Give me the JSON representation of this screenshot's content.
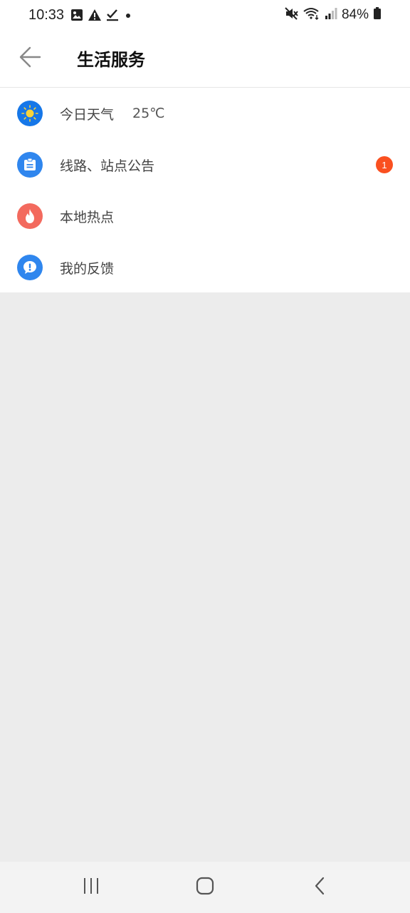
{
  "status_bar": {
    "time": "10:33",
    "battery": "84%",
    "left_icons": [
      "image-icon",
      "warning-icon",
      "check-icon",
      "dot-icon"
    ],
    "right_icons": [
      "mute-icon",
      "wifi-icon",
      "signal-icon",
      "battery-icon"
    ]
  },
  "header": {
    "title": "生活服务",
    "back_icon": "arrow-left-icon"
  },
  "services": [
    {
      "label": "今日天气",
      "extra": "25℃",
      "icon": "sun-icon",
      "icon_bg": "#1677e8"
    },
    {
      "label": "线路、站点公告",
      "badge": "1",
      "icon": "clipboard-icon",
      "icon_bg": "#2f86ee"
    },
    {
      "label": "本地热点",
      "icon": "flame-icon",
      "icon_bg": "#f36a5e"
    },
    {
      "label": "我的反馈",
      "icon": "exclamation-icon",
      "icon_bg": "#2f86ee"
    }
  ],
  "colors": {
    "badge": "#fa5020",
    "background": "#ececec",
    "sun": "#f8d33a"
  },
  "nav_bar": {
    "icons": [
      "recent-apps-icon",
      "home-icon",
      "back-icon"
    ]
  }
}
